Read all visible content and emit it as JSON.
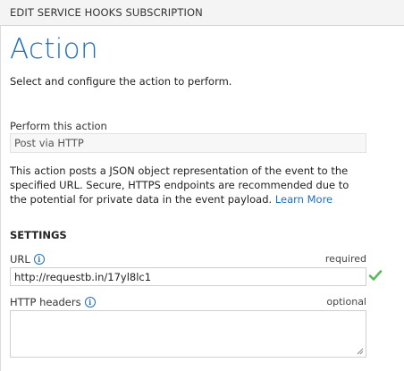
{
  "dialog": {
    "title": "EDIT SERVICE HOOKS SUBSCRIPTION"
  },
  "page": {
    "heading": "Action",
    "subtitle": "Select and configure the action to perform."
  },
  "action": {
    "label": "Perform this action",
    "selected": "Post via HTTP"
  },
  "description": {
    "text": "This action posts a JSON object representation of the event to the specified URL. Secure, HTTPS endpoints are recommended due to the potential for private data in the event payload. ",
    "link": "Learn More"
  },
  "settings": {
    "heading": "SETTINGS",
    "url": {
      "label": "URL",
      "hint": "required",
      "value": "http://requestb.in/17yl8lc1",
      "info_icon": "i"
    },
    "headers": {
      "label": "HTTP headers",
      "hint": "optional",
      "value": "",
      "info_icon": "i"
    }
  },
  "colors": {
    "accent": "#1f6fba",
    "valid": "#5cb85c"
  }
}
